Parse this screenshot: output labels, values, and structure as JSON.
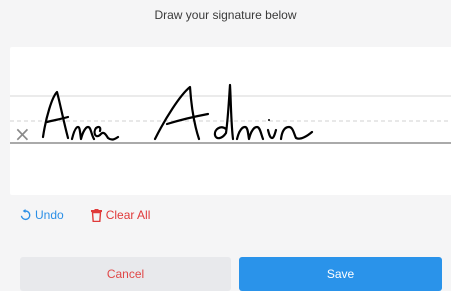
{
  "dialog": {
    "title": "Draw your signature below"
  },
  "signature": {
    "handwritten_text": "Anna Admin",
    "mark": "×"
  },
  "toolbar": {
    "undo_label": "Undo",
    "clear_label": "Clear All"
  },
  "footer": {
    "cancel_label": "Cancel",
    "save_label": "Save"
  },
  "colors": {
    "accent": "#2a93ea",
    "danger": "#e03a3a",
    "ink": "#000000"
  }
}
